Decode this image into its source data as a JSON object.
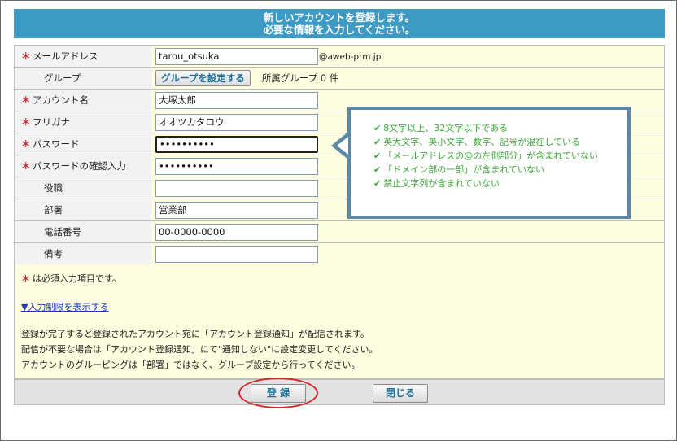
{
  "header": {
    "line1": "新しいアカウントを登録します。",
    "line2": "必要な情報を入力してください。"
  },
  "required_mark": "＊",
  "form": {
    "email": {
      "label": "メールアドレス",
      "value": "tarou_otsuka",
      "domain": "@aweb-prm.jp"
    },
    "group": {
      "label": "グループ",
      "button": "グループを設定する",
      "count": "所属グループ 0 件"
    },
    "account_name": {
      "label": "アカウント名",
      "value": "大塚太郎"
    },
    "furigana": {
      "label": "フリガナ",
      "value": "オオツカタロウ"
    },
    "password": {
      "label": "パスワード",
      "value": "••••••••••"
    },
    "password_confirm": {
      "label": "パスワードの確認入力",
      "value": "••••••••••"
    },
    "position": {
      "label": "役職",
      "value": ""
    },
    "department": {
      "label": "部署",
      "value": "営業部"
    },
    "phone": {
      "label": "電話番号",
      "value": "00-0000-0000"
    },
    "remarks": {
      "label": "備考",
      "value": ""
    }
  },
  "notes": {
    "required_note": "は必須入力項目です。",
    "restriction_link": "▼入力制限を表示する",
    "info": [
      "登録が完了すると登録されたアカウント宛に「アカウント登録通知」が配信されます。",
      "配信が不要な場合は「アカウント登録通知」にて\"通知しない\"に設定変更してください。",
      "アカウントのグルーピングは「部署」ではなく、グループ設定から行ってください。"
    ]
  },
  "password_rules": {
    "check_icon": "check-icon",
    "color": "#3ea83a",
    "items": [
      "8文字以上、32文字以下である",
      "英大文字、英小文字、数字、記号が混在している",
      "「メールアドレスの@の左側部分」が含まれていない",
      "「ドメイン部の一部」が含まれていない",
      "禁止文字列が含まれていない"
    ]
  },
  "footer": {
    "register_button": "登 録",
    "close_button": "閉じる"
  },
  "colors": {
    "header_bg": "#3d9ac4",
    "required": "#d8262b",
    "value_bg": "#fffde0",
    "highlight_ring": "#d8262b"
  }
}
